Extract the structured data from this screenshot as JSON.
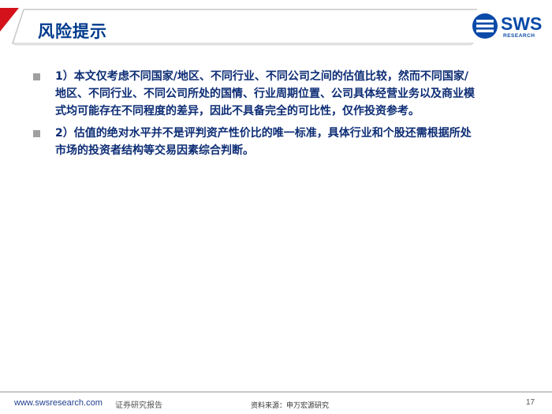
{
  "header": {
    "title": "风险提示",
    "logo": {
      "brand": "SWS",
      "subtitle": "RESEARCH"
    }
  },
  "colors": {
    "accent_red": "#d4121b",
    "title_blue": "#003a8c",
    "text_blue": "#0d2d75",
    "bullet_gray": "#a0a0a0"
  },
  "bullets": [
    {
      "text": "1）本文仅考虑不同国家/地区、不同行业、不同公司之间的估值比较，然而不同国家/\n地区、不同行业、不同公司所处的国情、行业周期位置、公司具体经营业务以及商业模\n式均可能存在不同程度的差异，因此不具备完全的可比性，仅作投资参考。"
    },
    {
      "text": "2）估值的绝对水平并不是评判资产性价比的唯一标准，具体行业和个股还需根据所处\n市场的投资者结构等交易因素综合判断。"
    }
  ],
  "footer": {
    "url": "www.swsresearch.com",
    "label": "证券研究报告",
    "source": "资料来源：申万宏源研究",
    "page": "17"
  }
}
